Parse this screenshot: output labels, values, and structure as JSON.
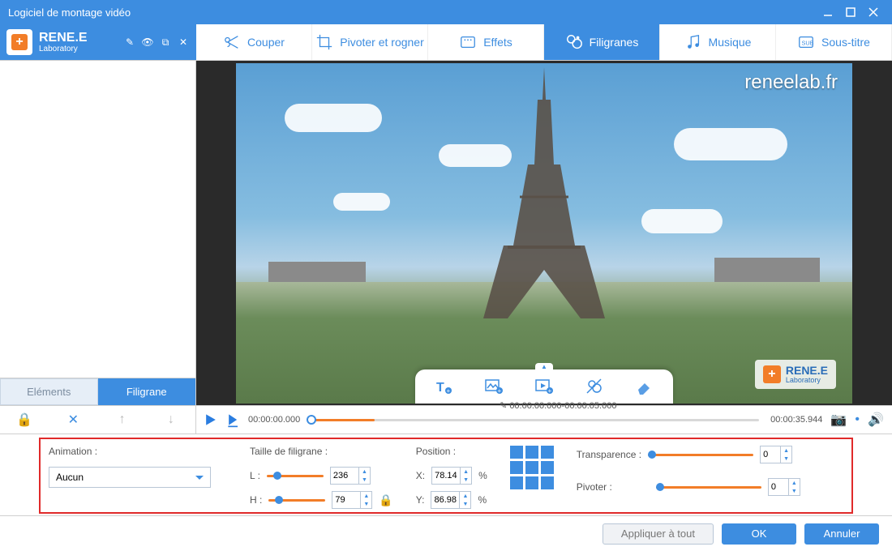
{
  "window": {
    "title": "Logiciel de montage vidéo"
  },
  "brand": {
    "name": "RENE.E",
    "sub": "Laboratory",
    "url": "reneelab.fr"
  },
  "tabs": {
    "cut": "Couper",
    "rotate_crop": "Pivoter et rogner",
    "effects": "Effets",
    "watermarks": "Filigranes",
    "music": "Musique",
    "subtitle": "Sous-titre"
  },
  "sidebar_tabs": {
    "elements": "Eléments",
    "watermark": "Filigrane"
  },
  "playback": {
    "current": "00:00:00.000",
    "range": "00:00:00.000-00:00:05.000",
    "total": "00:00:35.944",
    "fill_percent": 14
  },
  "params": {
    "animation_label": "Animation :",
    "animation_value": "Aucun",
    "size_label": "Taille de filigrane :",
    "L_label": "L :",
    "H_label": "H :",
    "L_value": "236",
    "H_value": "79",
    "position_label": "Position :",
    "X_label": "X:",
    "Y_label": "Y:",
    "X_value": "78.14",
    "Y_value": "86.98",
    "percent": "%",
    "transparency_label": "Transparence :",
    "transparency_value": "0",
    "rotate_label": "Pivoter :",
    "rotate_value": "0"
  },
  "footer": {
    "apply_all": "Appliquer à tout",
    "ok": "OK",
    "cancel": "Annuler"
  }
}
